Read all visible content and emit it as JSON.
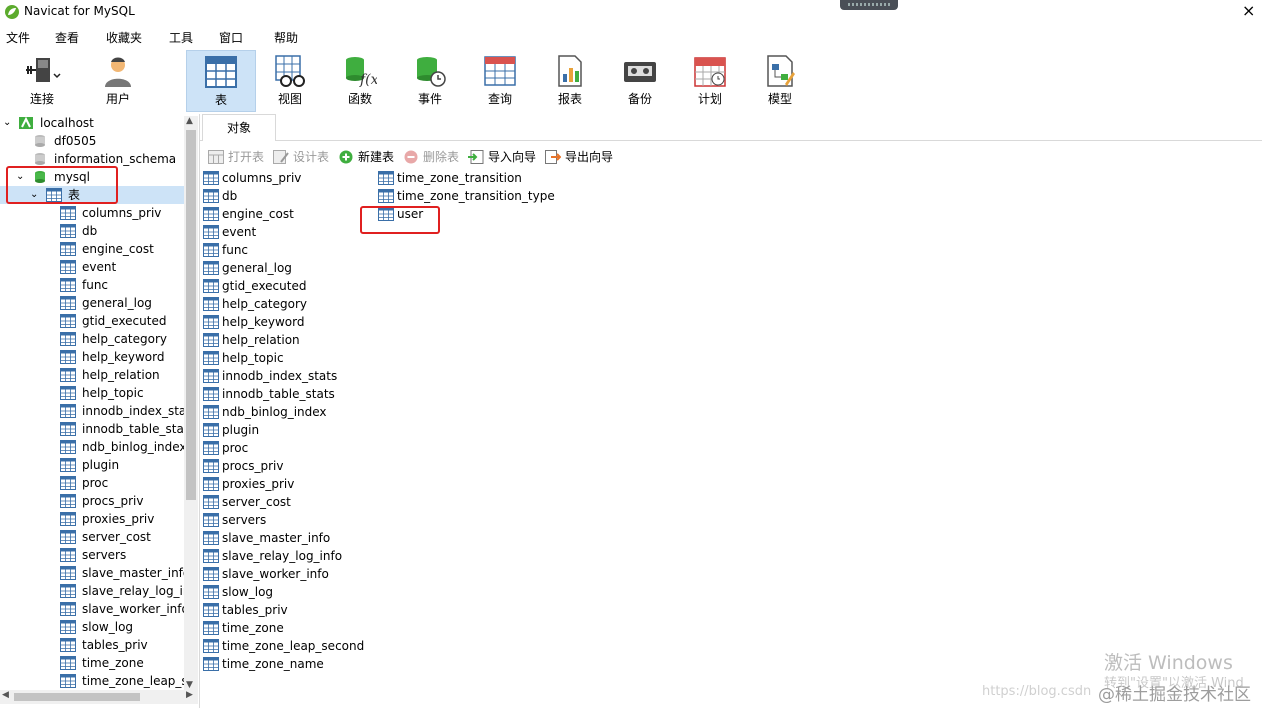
{
  "window": {
    "title": "Navicat for MySQL",
    "close_glyph": "×"
  },
  "menu": [
    "文件",
    "查看",
    "收藏夹",
    "工具",
    "窗口",
    "帮助"
  ],
  "toolbar": [
    {
      "label": "连接",
      "icon": "plug-connect-icon"
    },
    {
      "label": "用户",
      "icon": "user-icon"
    },
    {
      "label": "表",
      "icon": "table-icon",
      "active": true
    },
    {
      "label": "视图",
      "icon": "view-glasses-icon"
    },
    {
      "label": "函数",
      "icon": "function-icon"
    },
    {
      "label": "事件",
      "icon": "event-clock-icon"
    },
    {
      "label": "查询",
      "icon": "query-icon"
    },
    {
      "label": "报表",
      "icon": "report-icon"
    },
    {
      "label": "备份",
      "icon": "backup-icon"
    },
    {
      "label": "计划",
      "icon": "calendar-icon"
    },
    {
      "label": "模型",
      "icon": "model-icon"
    }
  ],
  "sidebar": {
    "connection": "localhost",
    "databases": [
      "df0505",
      "information_schema",
      "mysql"
    ],
    "tables_node": "表",
    "tables": [
      "columns_priv",
      "db",
      "engine_cost",
      "event",
      "func",
      "general_log",
      "gtid_executed",
      "help_category",
      "help_keyword",
      "help_relation",
      "help_topic",
      "innodb_index_stat",
      "innodb_table_stat",
      "ndb_binlog_index",
      "plugin",
      "proc",
      "procs_priv",
      "proxies_priv",
      "server_cost",
      "servers",
      "slave_master_info",
      "slave_relay_log_in",
      "slave_worker_info",
      "slow_log",
      "tables_priv",
      "time_zone",
      "time_zone_leap_se"
    ]
  },
  "objects_tab": "对象",
  "object_toolbar": [
    {
      "label": "打开表",
      "enabled": false,
      "icon": "open-table-icon"
    },
    {
      "label": "设计表",
      "enabled": false,
      "icon": "design-table-icon"
    },
    {
      "label": "新建表",
      "enabled": true,
      "icon": "new-table-icon"
    },
    {
      "label": "删除表",
      "enabled": false,
      "icon": "delete-table-icon"
    },
    {
      "label": "导入向导",
      "enabled": true,
      "icon": "import-wizard-icon"
    },
    {
      "label": "导出向导",
      "enabled": true,
      "icon": "export-wizard-icon"
    }
  ],
  "objects": {
    "column1": [
      "columns_priv",
      "db",
      "engine_cost",
      "event",
      "func",
      "general_log",
      "gtid_executed",
      "help_category",
      "help_keyword",
      "help_relation",
      "help_topic",
      "innodb_index_stats",
      "innodb_table_stats",
      "ndb_binlog_index",
      "plugin",
      "proc",
      "procs_priv",
      "proxies_priv",
      "server_cost",
      "servers",
      "slave_master_info",
      "slave_relay_log_info",
      "slave_worker_info",
      "slow_log",
      "tables_priv",
      "time_zone",
      "time_zone_leap_second",
      "time_zone_name"
    ],
    "column2": [
      "time_zone_transition",
      "time_zone_transition_type",
      "user"
    ]
  },
  "watermarks": {
    "activate": "激活 Windows",
    "activate_sub": "转到\"设置\"以激活 Wind",
    "url": "https://blog.csdn",
    "community": "@稀土掘金技术社区"
  },
  "colors": {
    "accent": "#cde3f7",
    "highlight_box": "#e02020",
    "db_green": "#3fae3f"
  }
}
